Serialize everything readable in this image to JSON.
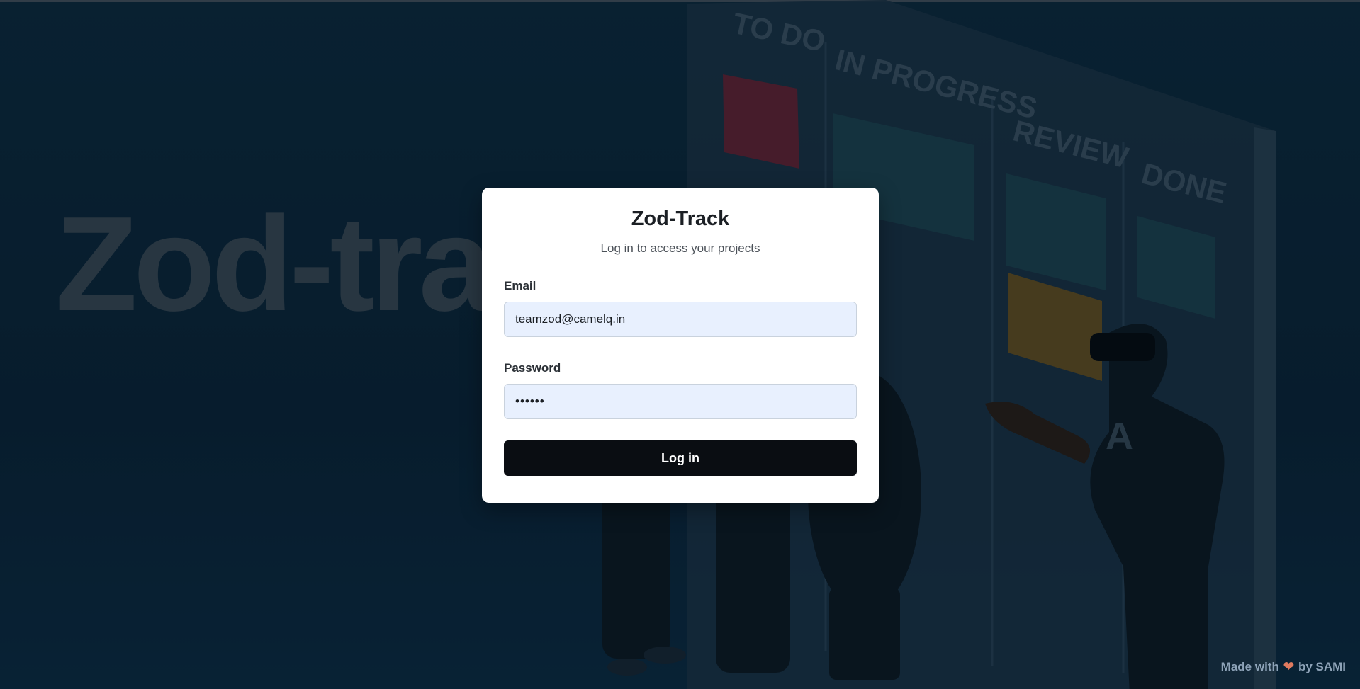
{
  "background": {
    "hero_text": "Zod-trac",
    "board_columns": [
      "TO DO",
      "IN PROGRESS",
      "REVIEW",
      "DONE"
    ],
    "shirt_letter": "A"
  },
  "login": {
    "title": "Zod-Track",
    "subtitle": "Log in to access your projects",
    "email_label": "Email",
    "email_value": "teamzod@camelq.in",
    "password_label": "Password",
    "password_value": "••••••",
    "submit_label": "Log in"
  },
  "footer": {
    "prefix": "Made with",
    "icon": "heart-icon",
    "suffix": "by SAMI"
  },
  "colors": {
    "background": "#0b2233",
    "card": "#ffffff",
    "input_fill": "#e8f0fe",
    "button": "#0a0d12",
    "heart": "#e07a5f"
  }
}
